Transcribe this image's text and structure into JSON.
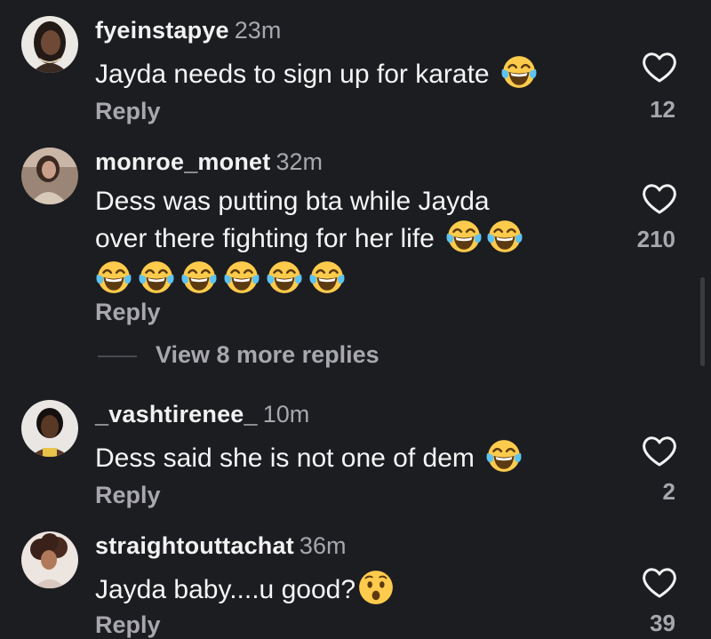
{
  "comments": [
    {
      "username": "fyeinstapye",
      "time": "23m",
      "text": "Jayda needs to sign up for karate",
      "reply_label": "Reply",
      "likes": "12",
      "emoji": "tears-of-joy"
    },
    {
      "username": "monroe_monet",
      "time": "32m",
      "text_line1": "Dess was putting bta while Jayda",
      "text_line2": "over there fighting for her life",
      "reply_label": "Reply",
      "likes": "210",
      "emoji": "tears-of-joy"
    },
    {
      "username": "_vashtirenee_",
      "time": "10m",
      "text": "Dess said she is not one of dem",
      "reply_label": "Reply",
      "likes": "2",
      "emoji": "tears-of-joy"
    },
    {
      "username": "straightouttachat",
      "time": "36m",
      "text": "Jayda baby....u good?",
      "reply_label": "Reply",
      "likes": "39",
      "emoji": "astonished-face"
    }
  ],
  "view_more": "View 8 more replies",
  "colors": {
    "background": "#1c1d21",
    "text_primary": "#f5f5f5",
    "text_secondary": "#a7a7ad",
    "emoji_yellow": "#ffcb4c"
  },
  "icons": {
    "like": "heart-outline-icon",
    "laugh": "tears-of-joy-emoji",
    "surprised": "astonished-face-emoji"
  }
}
